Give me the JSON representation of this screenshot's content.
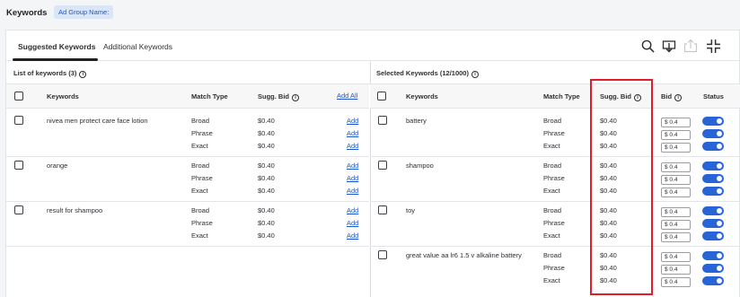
{
  "page": {
    "title": "Keywords",
    "ad_group_label": "Ad Group Name:"
  },
  "tabs": [
    {
      "label": "Suggested Keywords",
      "active": true
    },
    {
      "label": "Additional Keywords",
      "active": false
    }
  ],
  "toolbar": {
    "icons": [
      "search-icon",
      "download-icon",
      "upload-icon",
      "collapse-icon"
    ]
  },
  "left_panel": {
    "title": "List of keywords (3)",
    "columns": {
      "keywords": "Keywords",
      "match_type": "Match Type",
      "sugg_bid": "Sugg. Bid",
      "add_all": "Add All"
    },
    "add_label": "Add",
    "groups": [
      {
        "keyword": "nivea men protect care face lotion",
        "rows": [
          {
            "match": "Broad",
            "bid": "$0.40"
          },
          {
            "match": "Phrase",
            "bid": "$0.40"
          },
          {
            "match": "Exact",
            "bid": "$0.40"
          }
        ]
      },
      {
        "keyword": "orange",
        "rows": [
          {
            "match": "Broad",
            "bid": "$0.40"
          },
          {
            "match": "Phrase",
            "bid": "$0.40"
          },
          {
            "match": "Exact",
            "bid": "$0.40"
          }
        ]
      },
      {
        "keyword": "result for shampoo",
        "rows": [
          {
            "match": "Broad",
            "bid": "$0.40"
          },
          {
            "match": "Phrase",
            "bid": "$0.40"
          },
          {
            "match": "Exact",
            "bid": "$0.40"
          }
        ]
      }
    ]
  },
  "right_panel": {
    "title": "Selected Keywords (12/1000)",
    "columns": {
      "keywords": "Keywords",
      "match_type": "Match Type",
      "sugg_bid": "Sugg. Bid",
      "bid": "Bid",
      "status": "Status"
    },
    "groups": [
      {
        "keyword": "battery",
        "rows": [
          {
            "match": "Broad",
            "sugg": "$0.40",
            "bid": "$ 0.4"
          },
          {
            "match": "Phrase",
            "sugg": "$0.40",
            "bid": "$ 0.4"
          },
          {
            "match": "Exact",
            "sugg": "$0.40",
            "bid": "$ 0.4"
          }
        ]
      },
      {
        "keyword": "shampoo",
        "rows": [
          {
            "match": "Broad",
            "sugg": "$0.40",
            "bid": "$ 0.4"
          },
          {
            "match": "Phrase",
            "sugg": "$0.40",
            "bid": "$ 0.4"
          },
          {
            "match": "Exact",
            "sugg": "$0.40",
            "bid": "$ 0.4"
          }
        ]
      },
      {
        "keyword": "toy",
        "rows": [
          {
            "match": "Broad",
            "sugg": "$0.40",
            "bid": "$ 0.4"
          },
          {
            "match": "Phrase",
            "sugg": "$0.40",
            "bid": "$ 0.4"
          },
          {
            "match": "Exact",
            "sugg": "$0.40",
            "bid": "$ 0.4"
          }
        ]
      },
      {
        "keyword": "great value aa lr6 1.5 v alkaline battery",
        "rows": [
          {
            "match": "Broad",
            "sugg": "$0.40",
            "bid": "$ 0.4"
          },
          {
            "match": "Phrase",
            "sugg": "$0.40",
            "bid": "$ 0.4"
          },
          {
            "match": "Exact",
            "sugg": "$0.40",
            "bid": "$ 0.4"
          }
        ]
      }
    ]
  },
  "colors": {
    "accent": "#1c57c9",
    "toggle_on": "#2664d8",
    "highlight": "#e11d2a"
  }
}
